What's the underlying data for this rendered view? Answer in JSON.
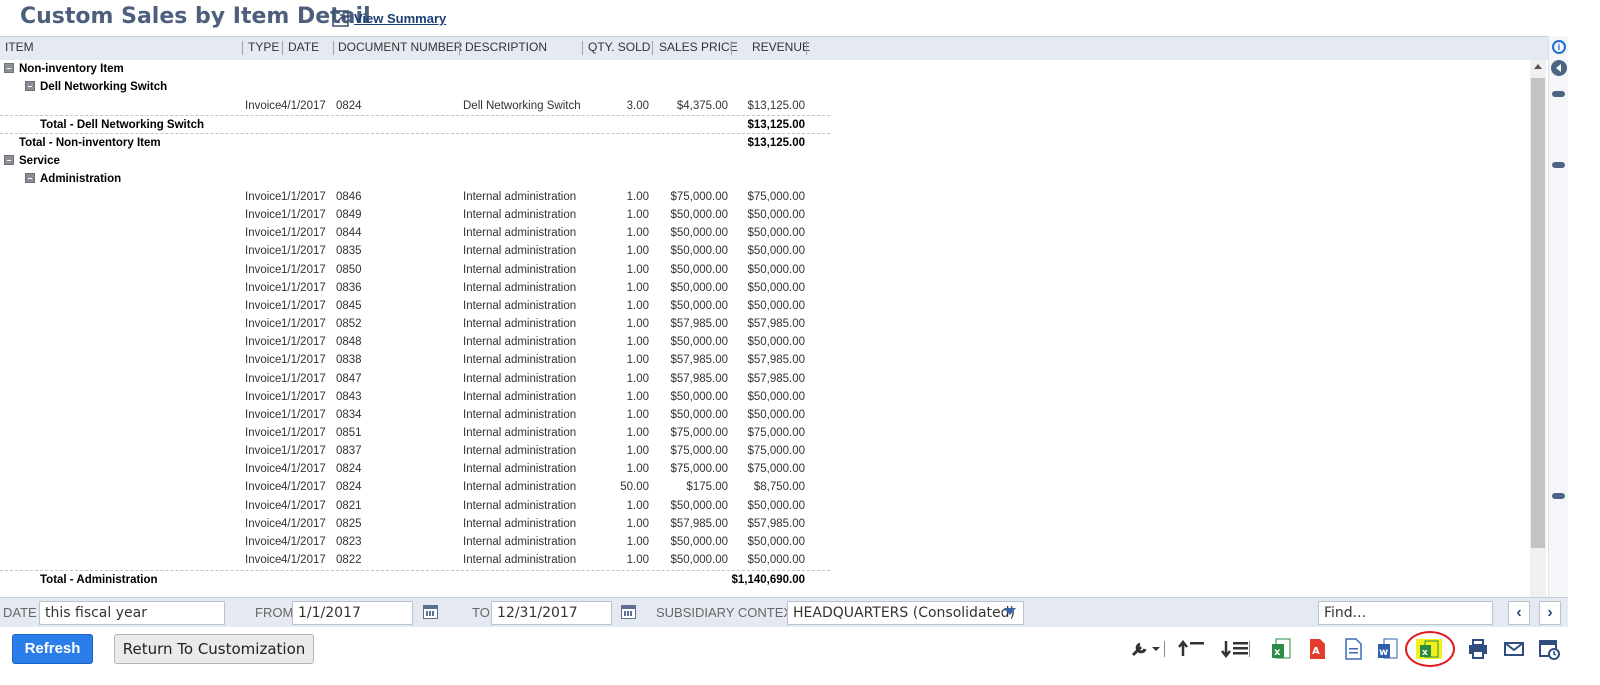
{
  "header": {
    "title": "Custom Sales by Item Detail",
    "view_summary": "View Summary"
  },
  "columns": [
    "ITEM",
    "TYPE",
    "DATE",
    "DOCUMENT NUMBER",
    "DESCRIPTION",
    "QTY. SOLD",
    "SALES PRICE",
    "REVENUE"
  ],
  "groups": {
    "noninventory": {
      "label": "Non-inventory Item",
      "total_label": "Total - Non-inventory Item",
      "total": "$13,125.00"
    },
    "dell": {
      "label": "Dell Networking Switch",
      "total_label": "Total - Dell Networking Switch",
      "total": "$13,125.00"
    },
    "service": {
      "label": "Service"
    },
    "admin": {
      "label": "Administration",
      "total_label": "Total - Administration",
      "total": "$1,140,690.00"
    }
  },
  "dell_rows": [
    {
      "type": "Invoice",
      "date": "4/1/2017",
      "doc": "0824",
      "desc": "Dell Networking Switch",
      "qty": "3.00",
      "price": "$4,375.00",
      "revenue": "$13,125.00"
    }
  ],
  "admin_rows": [
    {
      "type": "Invoice",
      "date": "1/1/2017",
      "doc": "0846",
      "desc": "Internal administration",
      "qty": "1.00",
      "price": "$75,000.00",
      "revenue": "$75,000.00"
    },
    {
      "type": "Invoice",
      "date": "1/1/2017",
      "doc": "0849",
      "desc": "Internal administration",
      "qty": "1.00",
      "price": "$50,000.00",
      "revenue": "$50,000.00"
    },
    {
      "type": "Invoice",
      "date": "1/1/2017",
      "doc": "0844",
      "desc": "Internal administration",
      "qty": "1.00",
      "price": "$50,000.00",
      "revenue": "$50,000.00"
    },
    {
      "type": "Invoice",
      "date": "1/1/2017",
      "doc": "0835",
      "desc": "Internal administration",
      "qty": "1.00",
      "price": "$50,000.00",
      "revenue": "$50,000.00"
    },
    {
      "type": "Invoice",
      "date": "1/1/2017",
      "doc": "0850",
      "desc": "Internal administration",
      "qty": "1.00",
      "price": "$50,000.00",
      "revenue": "$50,000.00"
    },
    {
      "type": "Invoice",
      "date": "1/1/2017",
      "doc": "0836",
      "desc": "Internal administration",
      "qty": "1.00",
      "price": "$50,000.00",
      "revenue": "$50,000.00"
    },
    {
      "type": "Invoice",
      "date": "1/1/2017",
      "doc": "0845",
      "desc": "Internal administration",
      "qty": "1.00",
      "price": "$50,000.00",
      "revenue": "$50,000.00"
    },
    {
      "type": "Invoice",
      "date": "1/1/2017",
      "doc": "0852",
      "desc": "Internal administration",
      "qty": "1.00",
      "price": "$57,985.00",
      "revenue": "$57,985.00"
    },
    {
      "type": "Invoice",
      "date": "1/1/2017",
      "doc": "0848",
      "desc": "Internal administration",
      "qty": "1.00",
      "price": "$50,000.00",
      "revenue": "$50,000.00"
    },
    {
      "type": "Invoice",
      "date": "1/1/2017",
      "doc": "0838",
      "desc": "Internal administration",
      "qty": "1.00",
      "price": "$57,985.00",
      "revenue": "$57,985.00"
    },
    {
      "type": "Invoice",
      "date": "1/1/2017",
      "doc": "0847",
      "desc": "Internal administration",
      "qty": "1.00",
      "price": "$57,985.00",
      "revenue": "$57,985.00"
    },
    {
      "type": "Invoice",
      "date": "1/1/2017",
      "doc": "0843",
      "desc": "Internal administration",
      "qty": "1.00",
      "price": "$50,000.00",
      "revenue": "$50,000.00"
    },
    {
      "type": "Invoice",
      "date": "1/1/2017",
      "doc": "0834",
      "desc": "Internal administration",
      "qty": "1.00",
      "price": "$50,000.00",
      "revenue": "$50,000.00"
    },
    {
      "type": "Invoice",
      "date": "1/1/2017",
      "doc": "0851",
      "desc": "Internal administration",
      "qty": "1.00",
      "price": "$75,000.00",
      "revenue": "$75,000.00"
    },
    {
      "type": "Invoice",
      "date": "1/1/2017",
      "doc": "0837",
      "desc": "Internal administration",
      "qty": "1.00",
      "price": "$75,000.00",
      "revenue": "$75,000.00"
    },
    {
      "type": "Invoice",
      "date": "4/1/2017",
      "doc": "0824",
      "desc": "Internal administration",
      "qty": "1.00",
      "price": "$75,000.00",
      "revenue": "$75,000.00"
    },
    {
      "type": "Invoice",
      "date": "4/1/2017",
      "doc": "0824",
      "desc": "Internal administration",
      "qty": "50.00",
      "price": "$175.00",
      "revenue": "$8,750.00"
    },
    {
      "type": "Invoice",
      "date": "4/1/2017",
      "doc": "0821",
      "desc": "Internal administration",
      "qty": "1.00",
      "price": "$50,000.00",
      "revenue": "$50,000.00"
    },
    {
      "type": "Invoice",
      "date": "4/1/2017",
      "doc": "0825",
      "desc": "Internal administration",
      "qty": "1.00",
      "price": "$57,985.00",
      "revenue": "$57,985.00"
    },
    {
      "type": "Invoice",
      "date": "4/1/2017",
      "doc": "0823",
      "desc": "Internal administration",
      "qty": "1.00",
      "price": "$50,000.00",
      "revenue": "$50,000.00"
    },
    {
      "type": "Invoice",
      "date": "4/1/2017",
      "doc": "0822",
      "desc": "Internal administration",
      "qty": "1.00",
      "price": "$50,000.00",
      "revenue": "$50,000.00"
    }
  ],
  "filters": {
    "date_label": "DATE",
    "date_value": "this fiscal year",
    "from_label": "FROM",
    "from_value": "1/1/2017",
    "to_label": "TO",
    "to_value": "12/31/2017",
    "subsidiary_label": "SUBSIDIARY CONTEXT",
    "subsidiary_value": "HEADQUARTERS (Consolidated)",
    "find_placeholder": "Find..."
  },
  "actions": {
    "refresh": "Refresh",
    "return": "Return To Customization"
  },
  "icons": [
    "wrench-icon",
    "collapse-all-icon",
    "expand-all-icon",
    "excel-export-icon",
    "pdf-export-icon",
    "csv-export-icon",
    "word-export-icon",
    "excel-highlighted-export-icon",
    "print-icon",
    "email-icon",
    "schedule-icon"
  ],
  "colors": {
    "title": "#4d5f7c",
    "accent": "#2b7de9",
    "header_bg": "#e5eaf2",
    "highlight": "#f2f21a",
    "highlight_ring": "#e0181b"
  }
}
